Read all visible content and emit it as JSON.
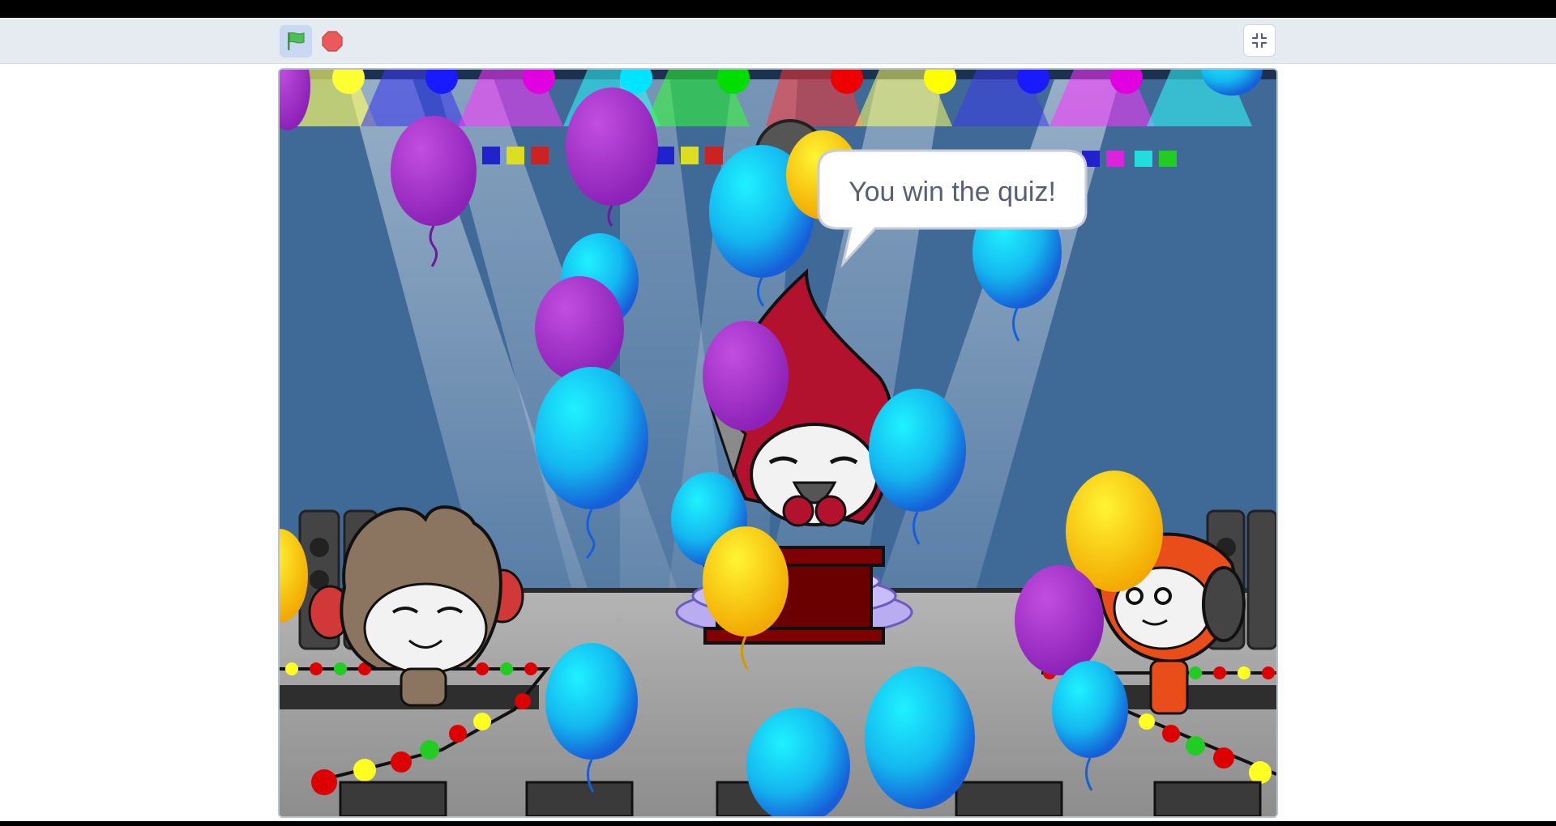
{
  "toolbar": {
    "green_flag_icon": "green-flag-icon",
    "stop_icon": "stop-sign-icon",
    "fullscreen_icon": "exit-fullscreen-icon"
  },
  "stage": {
    "speech_bubble": "You win the quiz!"
  },
  "colors": {
    "flag_green": "#4cbf56",
    "stop_red": "#ec5959",
    "stage_blue": "#3f6a98",
    "floor_gray": "#9a9a9a",
    "toolbar_bg": "#e6ebf2"
  }
}
